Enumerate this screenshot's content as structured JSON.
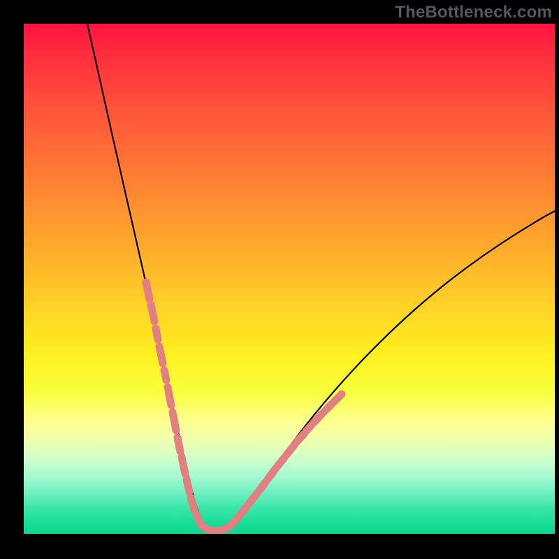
{
  "watermark": "TheBottleneck.com",
  "colors": {
    "curve": "#000000",
    "markers": "#e27f83",
    "background_black": "#000000"
  },
  "chart_data": {
    "type": "line",
    "title": "",
    "xlabel": "",
    "ylabel": "",
    "xlim": [
      0,
      100
    ],
    "ylim": [
      0,
      100
    ],
    "grid": false,
    "legend": false,
    "series": [
      {
        "name": "bottleneck-curve",
        "x": [
          12,
          14,
          16,
          18,
          20,
          22,
          24,
          25,
          26,
          27,
          28,
          29,
          30,
          31,
          32,
          33,
          34,
          35,
          37,
          40,
          45,
          50,
          55,
          60,
          65,
          70,
          75,
          80,
          85,
          90,
          95,
          100
        ],
        "y": [
          100,
          90,
          81,
          72,
          63,
          55,
          46,
          40,
          35,
          28,
          22,
          15,
          9,
          4,
          1,
          0,
          0,
          1,
          3,
          8,
          15,
          22,
          29,
          35,
          41,
          46,
          51,
          55,
          59,
          62,
          65,
          67
        ]
      }
    ],
    "markers": {
      "name": "highlighted-range",
      "left_branch": [
        {
          "x": 23.0,
          "y": 50
        },
        {
          "x": 23.8,
          "y": 44
        },
        {
          "x": 24.3,
          "y": 40
        },
        {
          "x": 25.0,
          "y": 36
        },
        {
          "x": 25.3,
          "y": 33
        },
        {
          "x": 26.0,
          "y": 29
        },
        {
          "x": 26.8,
          "y": 24
        },
        {
          "x": 27.3,
          "y": 20
        },
        {
          "x": 28.0,
          "y": 16
        },
        {
          "x": 28.6,
          "y": 12
        },
        {
          "x": 29.3,
          "y": 8
        },
        {
          "x": 30.2,
          "y": 4
        }
      ],
      "bottom": [
        {
          "x": 31.0,
          "y": 1.5
        },
        {
          "x": 32.0,
          "y": 0.8
        },
        {
          "x": 33.0,
          "y": 0.5
        },
        {
          "x": 34.0,
          "y": 0.5
        },
        {
          "x": 35.0,
          "y": 0.8
        },
        {
          "x": 36.0,
          "y": 1.5
        }
      ],
      "right_branch": [
        {
          "x": 37.0,
          "y": 3
        },
        {
          "x": 38.5,
          "y": 6
        },
        {
          "x": 40.0,
          "y": 9
        },
        {
          "x": 41.5,
          "y": 11
        },
        {
          "x": 43.0,
          "y": 14
        },
        {
          "x": 44.0,
          "y": 15.5
        },
        {
          "x": 45.5,
          "y": 18
        },
        {
          "x": 47.0,
          "y": 20
        },
        {
          "x": 48.0,
          "y": 21.5
        },
        {
          "x": 49.5,
          "y": 23.5
        },
        {
          "x": 51.0,
          "y": 25.5
        },
        {
          "x": 52.5,
          "y": 27.5
        }
      ]
    }
  }
}
